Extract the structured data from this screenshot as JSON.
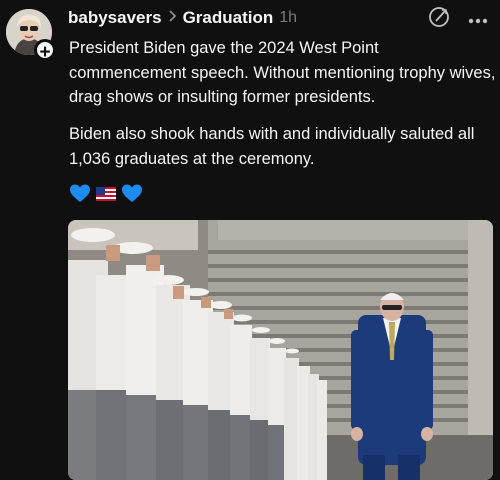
{
  "post": {
    "username": "babysavers",
    "community": "Graduation",
    "time": "1h",
    "paragraph1": "President Biden gave the 2024 West Point commencement speech. Without mentioning trophy wives, drag shows or insulting former presidents.",
    "paragraph2": "Biden also shook hands with and individually saluted all 1,036 graduates at the ceremony.",
    "emojis": [
      "blue-heart",
      "us-flag",
      "blue-heart"
    ]
  },
  "icons": {
    "separator": "chevron-right-icon",
    "header_action": "edit-circle-icon",
    "more": "more-icon",
    "follow": "plus-icon"
  },
  "colors": {
    "background": "#101010",
    "text": "#f3f5f7",
    "muted": "#777a7e",
    "heart": "#1d8cf0"
  }
}
